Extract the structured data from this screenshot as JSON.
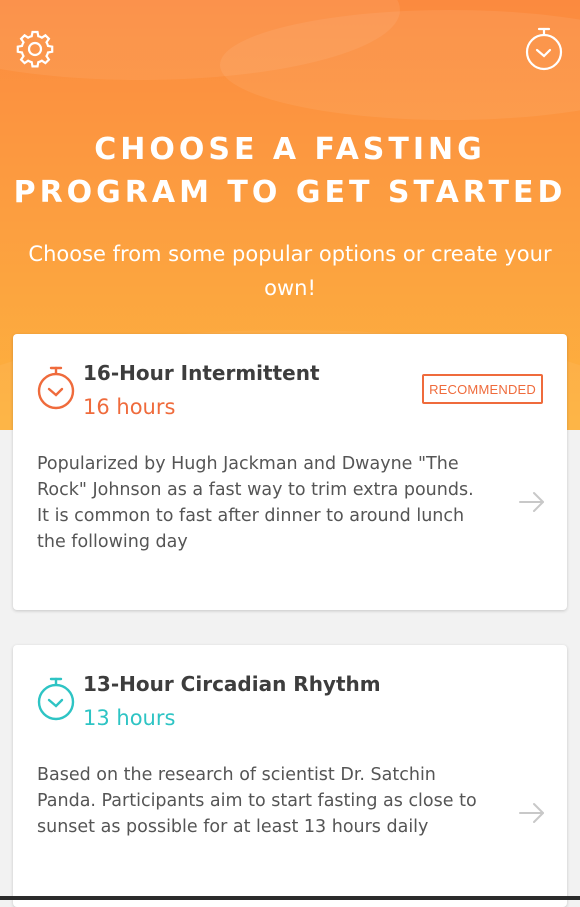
{
  "header": {
    "title_line1": "CHOOSE A FASTING",
    "title_line2": "PROGRAM TO GET STARTED",
    "subtitle": "Choose from some popular options or create your own!",
    "settings_icon": "gear-icon",
    "timer_icon": "stopwatch-icon"
  },
  "colors": {
    "header_top": "#fb8a3f",
    "header_bottom": "#fdb23e",
    "accent_orange": "#ef6b3c",
    "accent_teal": "#2ec4c4"
  },
  "programs": [
    {
      "name": "16-Hour Intermittent",
      "duration": "16 hours",
      "badge": "RECOMMENDED",
      "description": "Popularized by Hugh Jackman and Dwayne \"The Rock\" Johnson as a fast way to trim extra pounds. It is common to fast after dinner to around lunch the following day",
      "icon": "stopwatch-icon",
      "color": "#ef6b3c"
    },
    {
      "name": "13-Hour Circadian Rhythm",
      "duration": "13 hours",
      "description": "Based on the research of scientist Dr. Satchin Panda. Participants aim to start fasting as close to sunset as possible for at least 13 hours daily",
      "icon": "stopwatch-icon",
      "color": "#2ec4c4"
    }
  ]
}
